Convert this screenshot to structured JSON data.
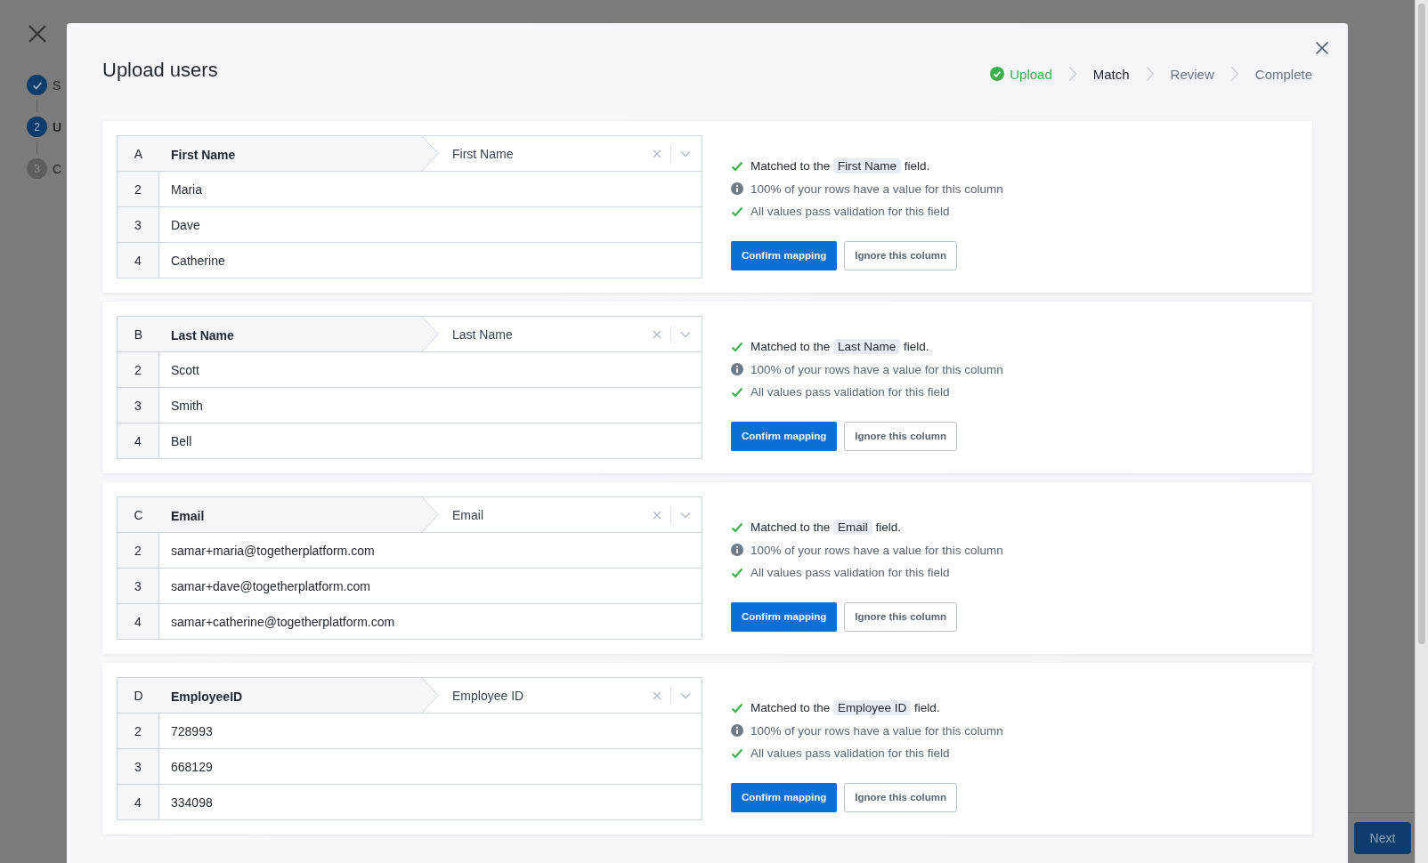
{
  "background": {
    "steps": [
      {
        "kind": "done",
        "label": "S"
      },
      {
        "kind": "current",
        "number": "2",
        "label": "U"
      },
      {
        "kind": "upcoming",
        "number": "3",
        "label": "C"
      }
    ],
    "next_button": "Next"
  },
  "modal": {
    "title": "Upload users",
    "steps": [
      {
        "kind": "done",
        "label": "Upload"
      },
      {
        "kind": "current",
        "label": "Match"
      },
      {
        "kind": "upcoming",
        "label": "Review"
      },
      {
        "kind": "upcoming",
        "label": "Complete"
      }
    ],
    "columns": [
      {
        "letter": "A",
        "header": "First Name",
        "mapped_field": "First Name",
        "rows": [
          {
            "number": "2",
            "value": "Maria"
          },
          {
            "number": "3",
            "value": "Dave"
          },
          {
            "number": "4",
            "value": "Catherine"
          }
        ],
        "messages": [
          {
            "kind": "match",
            "before": "Matched to the",
            "field": "First Name",
            "after": "field."
          },
          {
            "kind": "info",
            "text": "100% of your rows have a value for this column"
          },
          {
            "kind": "check",
            "text": "All values pass validation for this field"
          }
        ],
        "confirm_button": "Confirm mapping",
        "ignore_button": "Ignore this column"
      },
      {
        "letter": "B",
        "header": "Last Name",
        "mapped_field": "Last Name",
        "rows": [
          {
            "number": "2",
            "value": "Scott"
          },
          {
            "number": "3",
            "value": "Smith"
          },
          {
            "number": "4",
            "value": "Bell"
          }
        ],
        "messages": [
          {
            "kind": "match",
            "before": "Matched to the",
            "field": "Last Name",
            "after": "field."
          },
          {
            "kind": "info",
            "text": "100% of your rows have a value for this column"
          },
          {
            "kind": "check",
            "text": "All values pass validation for this field"
          }
        ],
        "confirm_button": "Confirm mapping",
        "ignore_button": "Ignore this column"
      },
      {
        "letter": "C",
        "header": "Email",
        "mapped_field": "Email",
        "rows": [
          {
            "number": "2",
            "value": "samar+maria@togetherplatform.com"
          },
          {
            "number": "3",
            "value": "samar+dave@togetherplatform.com"
          },
          {
            "number": "4",
            "value": "samar+catherine@togetherplatform.com"
          }
        ],
        "messages": [
          {
            "kind": "match",
            "before": "Matched to the",
            "field": "Email",
            "after": "field."
          },
          {
            "kind": "info",
            "text": "100% of your rows have a value for this column"
          },
          {
            "kind": "check",
            "text": "All values pass validation for this field"
          }
        ],
        "confirm_button": "Confirm mapping",
        "ignore_button": "Ignore this column"
      },
      {
        "letter": "D",
        "header": "EmployeeID",
        "mapped_field": "Employee ID",
        "rows": [
          {
            "number": "2",
            "value": "728993"
          },
          {
            "number": "3",
            "value": "668129"
          },
          {
            "number": "4",
            "value": "334098"
          }
        ],
        "messages": [
          {
            "kind": "match",
            "before": "Matched to the",
            "field": "Employee ID",
            "after": "field."
          },
          {
            "kind": "info",
            "text": "100% of your rows have a value for this column"
          },
          {
            "kind": "check",
            "text": "All values pass validation for this field"
          }
        ],
        "confirm_button": "Confirm mapping",
        "ignore_button": "Ignore this column"
      }
    ]
  }
}
